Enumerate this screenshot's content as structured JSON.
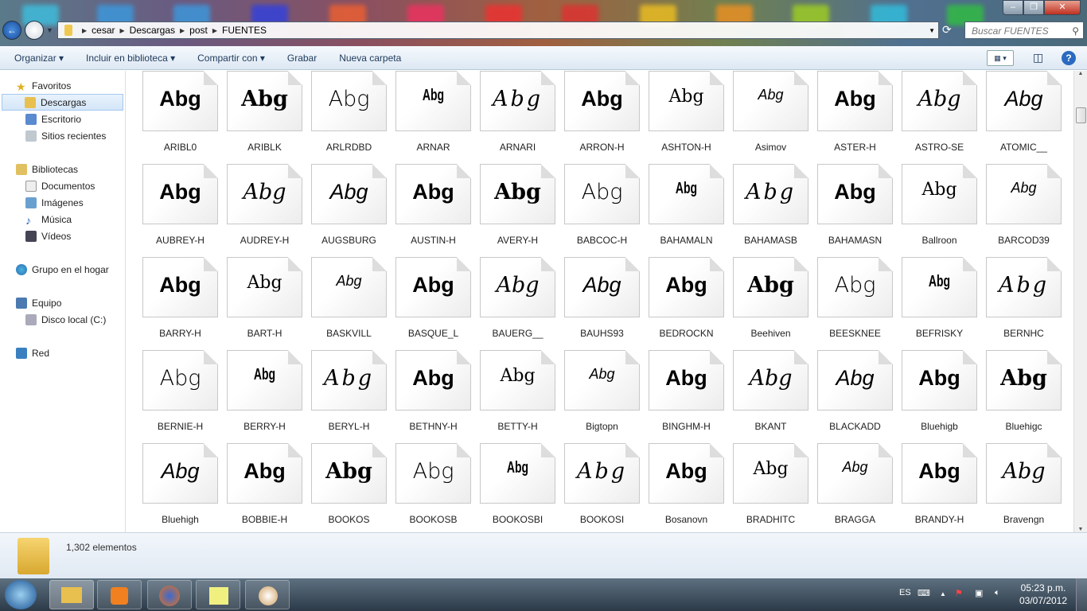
{
  "address": {
    "crumbs": [
      "cesar",
      "Descargas",
      "post",
      "FUENTES"
    ],
    "search_placeholder": "Buscar FUENTES"
  },
  "toolbar": {
    "organize": "Organizar ▾",
    "include": "Incluir en biblioteca ▾",
    "share": "Compartir con ▾",
    "burn": "Grabar",
    "new_folder": "Nueva carpeta"
  },
  "sidebar": {
    "favorites": "Favoritos",
    "downloads": "Descargas",
    "desktop": "Escritorio",
    "recent": "Sitios recientes",
    "libraries": "Bibliotecas",
    "documents": "Documentos",
    "images": "Imágenes",
    "music": "Música",
    "videos": "Vídeos",
    "homegroup": "Grupo en el hogar",
    "computer": "Equipo",
    "local_disk": "Disco local (C:)",
    "network": "Red"
  },
  "files": [
    "ARIBL0",
    "ARIBLK",
    "ARLRDBD",
    "ARNAR",
    "ARNARI",
    "ARRON-H",
    "ASHTON-H",
    "Asimov",
    "ASTER-H",
    "ASTRO-SE",
    "ATOMIC__",
    "AUBREY-H",
    "AUDREY-H",
    "AUGSBURG",
    "AUSTIN-H",
    "AVERY-H",
    "BABCOC-H",
    "BAHAMALN",
    "BAHAMASB",
    "BAHAMASN",
    "Ballroon",
    "BARCOD39",
    "BARRY-H",
    "BART-H",
    "BASKVILL",
    "BASQUE_L",
    "BAUERG__",
    "BAUHS93",
    "BEDROCKN",
    "Beehiven",
    "BEESKNEE",
    "BEFRISKY",
    "BERNHC",
    "BERNIE-H",
    "BERRY-H",
    "BERYL-H",
    "BETHNY-H",
    "BETTY-H",
    "Bigtopn",
    "BINGHM-H",
    "BKANT",
    "BLACKADD",
    "Bluehigb",
    "Bluehigc",
    "Bluehigh",
    "BOBBIE-H",
    "BOOKOS",
    "BOOKOSB",
    "BOOKOSBI",
    "BOOKOSI",
    "Bosanovn",
    "BRADHITC",
    "BRAGGA",
    "BRANDY-H",
    "Bravengn"
  ],
  "preview_text": "Abg",
  "status": {
    "count": "1,302 elementos"
  },
  "tray": {
    "lang": "ES",
    "time": "05:23 p.m.",
    "date": "03/07/2012"
  }
}
